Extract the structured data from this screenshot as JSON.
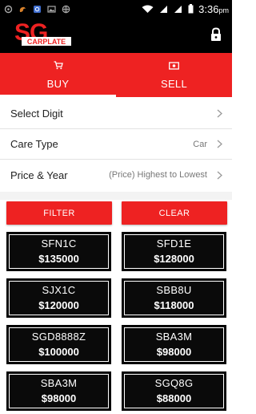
{
  "status_bar": {
    "time": "3:36",
    "time_suffix": "pm",
    "icons_left": [
      "settings-icon",
      "squirrel-icon",
      "app-icon",
      "image-icon",
      "globe-icon"
    ],
    "icons_right": [
      "wifi-icon",
      "signal-icon",
      "signal-icon",
      "battery-icon"
    ]
  },
  "app": {
    "logo_text": "SG",
    "logo_subtext": "CARPLATE",
    "accent_color": "#ee2222"
  },
  "tabs": [
    {
      "label": "BUY",
      "icon": "cart-icon",
      "active": true
    },
    {
      "label": "SELL",
      "icon": "money-icon",
      "active": false
    }
  ],
  "options": [
    {
      "label": "Select Digit",
      "value": ""
    },
    {
      "label": "Care Type",
      "value": "Car"
    },
    {
      "label": "Price & Year",
      "value": "(Price) Highest to Lowest"
    }
  ],
  "buttons": {
    "filter": "FILTER",
    "clear": "CLEAR"
  },
  "plates": [
    {
      "number": "SFN1C",
      "price": "$135000"
    },
    {
      "number": "SFD1E",
      "price": "$128000"
    },
    {
      "number": "SJX1C",
      "price": "$120000"
    },
    {
      "number": "SBB8U",
      "price": "$118000"
    },
    {
      "number": "SGD8888Z",
      "price": "$100000"
    },
    {
      "number": "SBA3M",
      "price": "$98000"
    },
    {
      "number": "SBA3M",
      "price": "$98000"
    },
    {
      "number": "SGQ8G",
      "price": "$88000"
    }
  ]
}
